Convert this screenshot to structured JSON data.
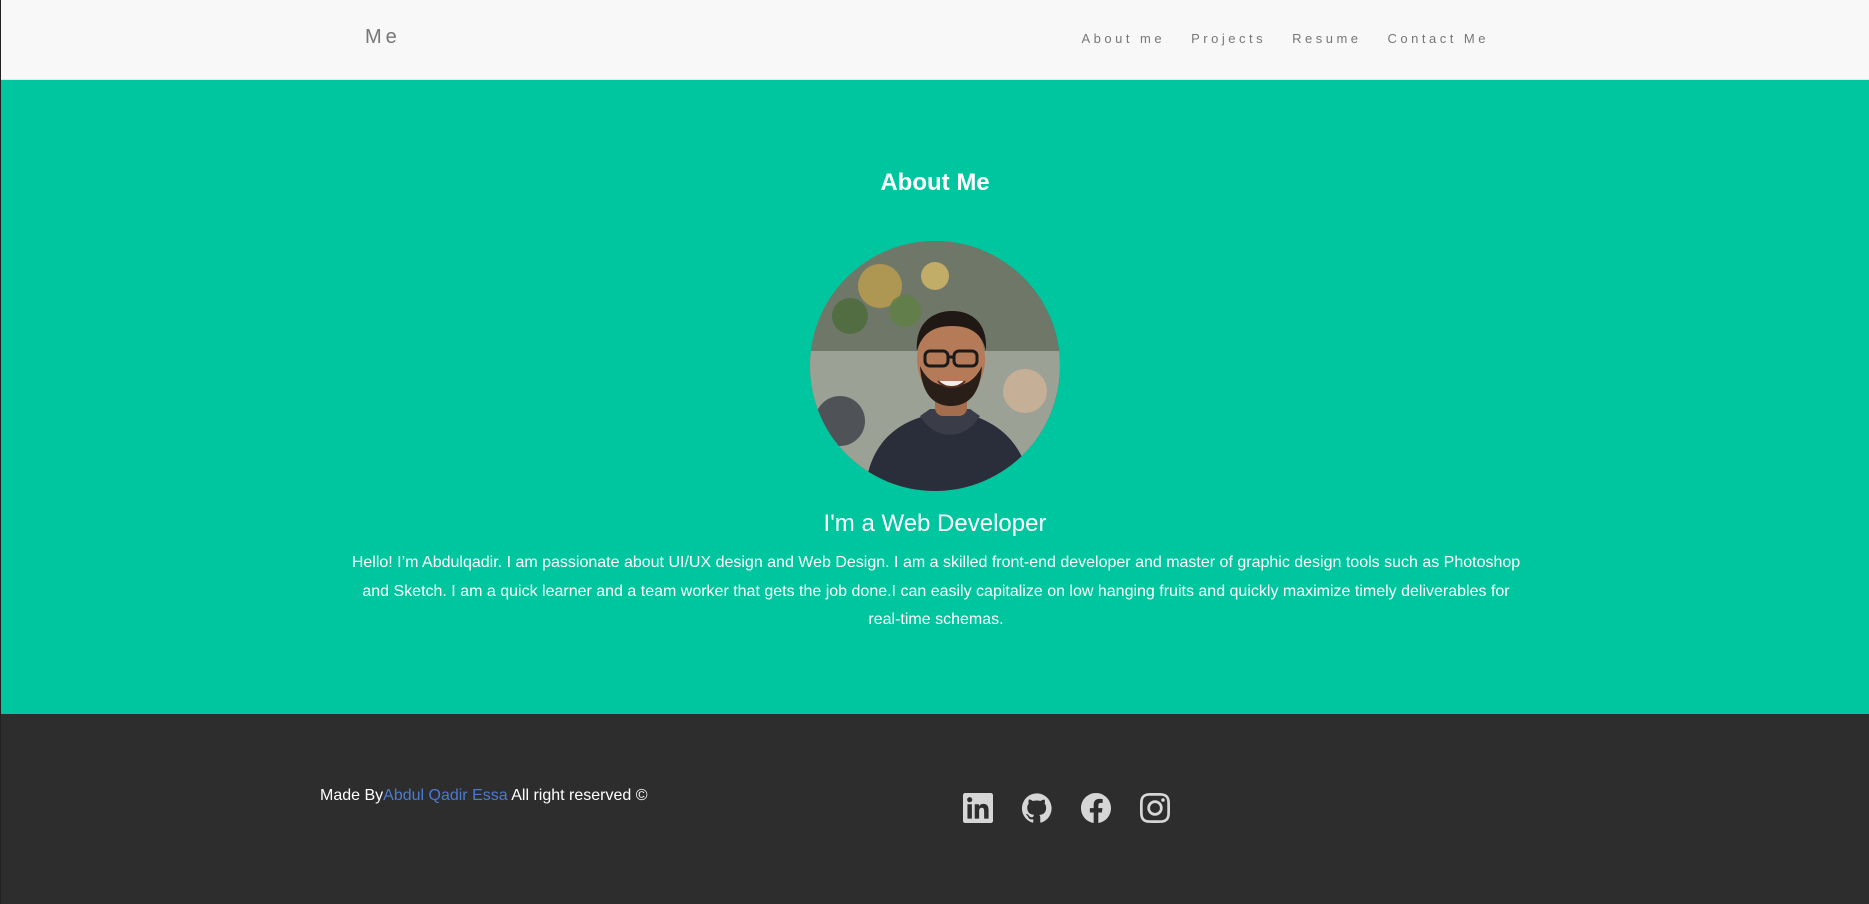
{
  "navbar": {
    "brand": "Me",
    "links": [
      {
        "label": "About me"
      },
      {
        "label": "Projects"
      },
      {
        "label": "Resume"
      },
      {
        "label": "Contact Me"
      }
    ]
  },
  "hero": {
    "title": "About Me",
    "subtitle": "I'm a Web Developer",
    "bio": "Hello! I’m Abdulqadir. I am passionate about UI/UX design and Web Design. I am a skilled front-end developer and master of graphic design tools such as Photoshop and Sketch. I am a quick learner and a team worker that gets the job done.I can easily capitalize on low hanging fruits and quickly maximize timely deliverables for real-time schemas.",
    "background_color": "#00c69f"
  },
  "footer": {
    "credit_prefix": "Made By",
    "credit_name": "Abdul Qadir Essa",
    "credit_suffix": " All right reserved ©",
    "background_color": "#2e2d2d",
    "social_icons": [
      "linkedin-icon",
      "github-icon",
      "facebook-icon",
      "instagram-icon"
    ]
  }
}
